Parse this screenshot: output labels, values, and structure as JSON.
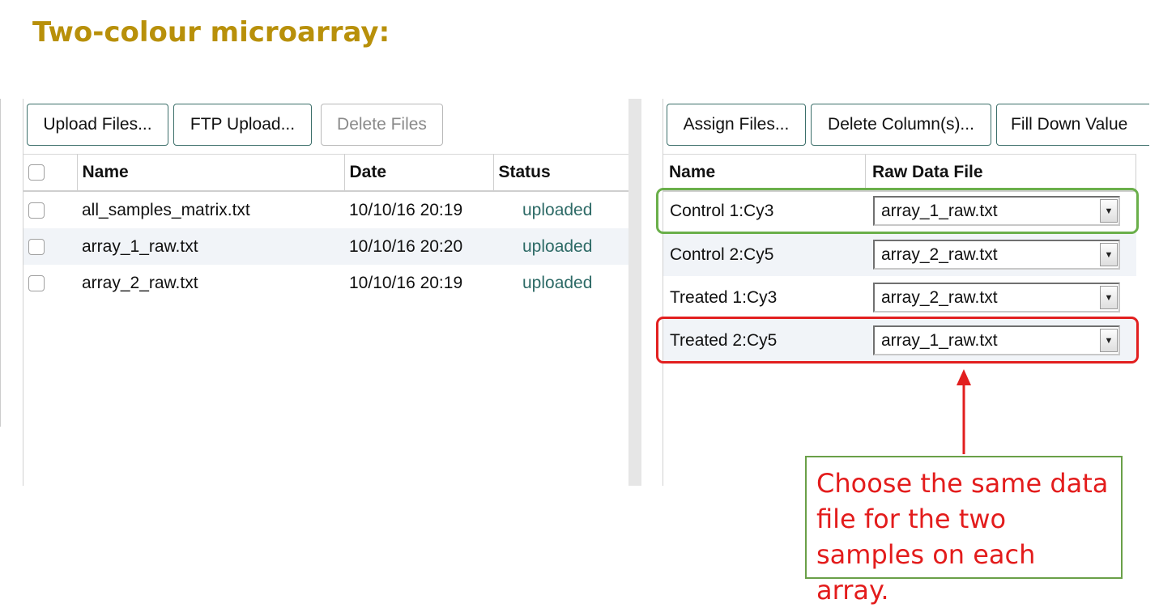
{
  "slide": {
    "title": "Two-colour microarray:"
  },
  "files_panel": {
    "toolbar": {
      "upload_label": "Upload Files...",
      "ftp_label": "FTP Upload...",
      "delete_label": "Delete Files"
    },
    "columns": [
      "Name",
      "Date",
      "Status"
    ],
    "rows": [
      {
        "name": "all_samples_matrix.txt",
        "date": "10/10/16 20:19",
        "status": "uploaded"
      },
      {
        "name": "array_1_raw.txt",
        "date": "10/10/16 20:20",
        "status": "uploaded"
      },
      {
        "name": "array_2_raw.txt",
        "date": "10/10/16 20:19",
        "status": "uploaded"
      }
    ]
  },
  "assign_panel": {
    "toolbar": {
      "assign_label": "Assign Files...",
      "delete_cols_label": "Delete Column(s)...",
      "fill_down_label": "Fill Down Value"
    },
    "columns": [
      "Name",
      "Raw Data File"
    ],
    "rows": [
      {
        "name": "Control 1:Cy3",
        "file": "array_1_raw.txt"
      },
      {
        "name": "Control 2:Cy5",
        "file": "array_2_raw.txt"
      },
      {
        "name": "Treated 1:Cy3",
        "file": "array_2_raw.txt"
      },
      {
        "name": "Treated 2:Cy5",
        "file": "array_1_raw.txt"
      }
    ]
  },
  "annotation": {
    "text": "Choose the same data file for the two samples on each array.",
    "text_color": "#e31c1c",
    "border_color": "#6aa048",
    "highlight_good_color": "#6aaf4a",
    "highlight_bad_color": "#e21f1f"
  },
  "colors": {
    "title": "#b8900a",
    "status_text": "#2d6a66",
    "button_border": "#3c6f6a"
  }
}
